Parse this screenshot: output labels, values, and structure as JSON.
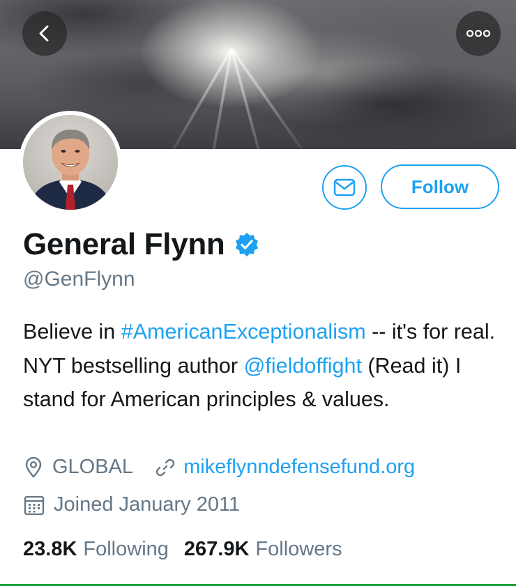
{
  "profile": {
    "name": "General Flynn",
    "handle": "@GenFlynn",
    "bio": {
      "line1_pre": "Believe in ",
      "hashtag": "#AmericanExceptionalism",
      "line1_post": " -- it's for real. NYT bestselling author ",
      "mention": "@fieldoffight",
      "line_end": " (Read it) I stand for American principles & values."
    },
    "location": "GLOBAL",
    "website": "mikeflynndefensefund.org",
    "joined": "Joined January 2011"
  },
  "stats": {
    "following_count": "23.8K",
    "following_label": "Following",
    "followers_count": "267.9K",
    "followers_label": "Followers"
  },
  "actions": {
    "follow_label": "Follow"
  },
  "icons": {
    "back": "chevron-left-icon",
    "more": "more-icon",
    "message": "envelope-icon",
    "verified": "verified-badge-icon",
    "location": "location-pin-icon",
    "link": "link-icon",
    "calendar": "calendar-icon"
  },
  "colors": {
    "accent": "#1da1f2",
    "secondary_text": "#657786",
    "primary_text": "#14171a"
  }
}
